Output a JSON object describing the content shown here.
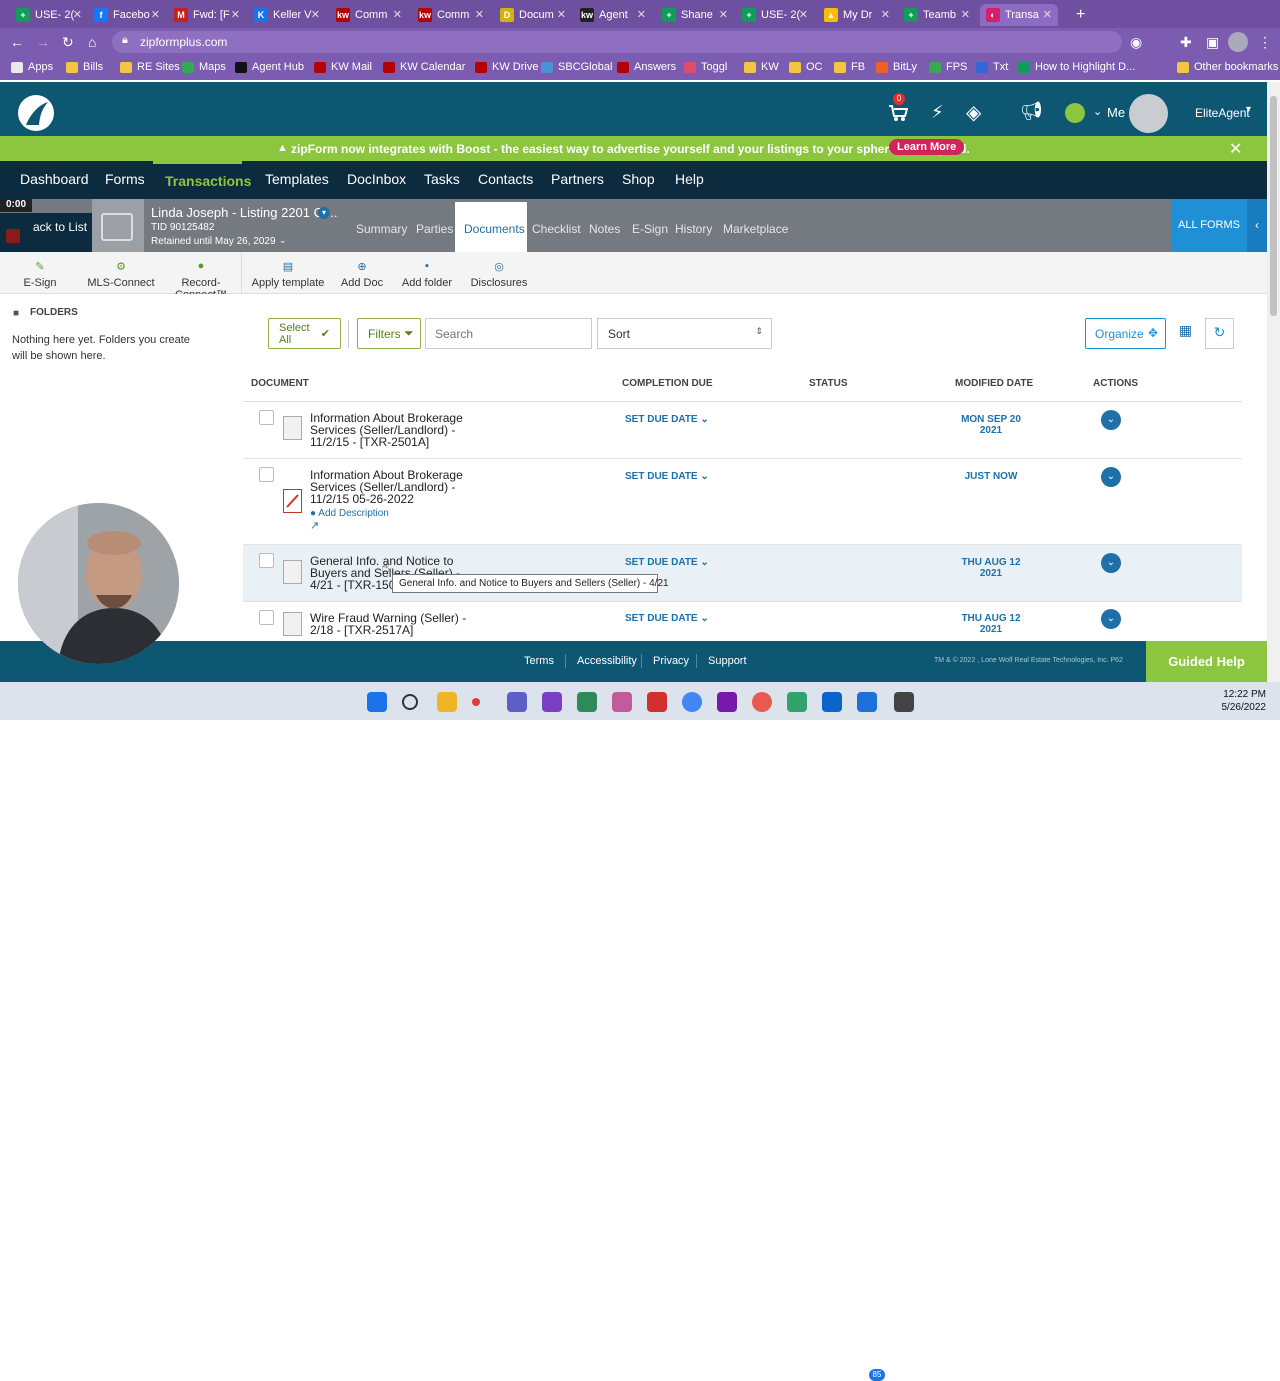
{
  "browser": {
    "tabs": [
      {
        "title": "USE- 2(",
        "color": "#0f9d58",
        "glyph": "+"
      },
      {
        "title": "Facebo",
        "color": "#1877f2",
        "glyph": "f"
      },
      {
        "title": "Fwd: [F",
        "color": "#c5221f",
        "glyph": "M"
      },
      {
        "title": "Keller V",
        "color": "#1a73e8",
        "glyph": "K"
      },
      {
        "title": "Comm",
        "color": "#b40101",
        "glyph": "kw"
      },
      {
        "title": "Comm",
        "color": "#b40101",
        "glyph": "kw"
      },
      {
        "title": "Docum",
        "color": "#d4b20a",
        "glyph": "D"
      },
      {
        "title": "Agent",
        "color": "#222222",
        "glyph": "kw"
      },
      {
        "title": "Shane",
        "color": "#0f9d58",
        "glyph": "+"
      },
      {
        "title": "USE- 2(",
        "color": "#0f9d58",
        "glyph": "+"
      },
      {
        "title": "My Dr",
        "color": "#fbbc04",
        "glyph": "▲"
      },
      {
        "title": "Teamb",
        "color": "#0f9d58",
        "glyph": "+"
      },
      {
        "title": "Transa",
        "color": "#d61f69",
        "glyph": "◐"
      }
    ],
    "new_tab": "+",
    "url": "zipformplus.com",
    "bookmarks": [
      {
        "label": "Apps",
        "color": "#e9e9e9"
      },
      {
        "label": "Bills",
        "color": "#f4c542"
      },
      {
        "label": "RE Sites",
        "color": "#f4c542"
      },
      {
        "label": "Maps",
        "color": "#34a853"
      },
      {
        "label": "Agent Hub",
        "color": "#111111"
      },
      {
        "label": "KW Mail",
        "color": "#b40101"
      },
      {
        "label": "KW Calendar",
        "color": "#b40101"
      },
      {
        "label": "KW Drive",
        "color": "#b40101"
      },
      {
        "label": "SBCGlobal",
        "color": "#4b8fd6"
      },
      {
        "label": "Answers",
        "color": "#b40101"
      },
      {
        "label": "Toggl",
        "color": "#e24c6b"
      },
      {
        "label": "KW",
        "color": "#f4c542"
      },
      {
        "label": "OC",
        "color": "#f4c542"
      },
      {
        "label": "FB",
        "color": "#f4c542"
      },
      {
        "label": "BitLy",
        "color": "#ee6123"
      },
      {
        "label": "FPS",
        "color": "#3aa757"
      },
      {
        "label": "Txt",
        "color": "#3367d6"
      },
      {
        "label": "How to Highlight D...",
        "color": "#0f9d58"
      },
      {
        "label": "Other bookmarks",
        "color": "#f4c542"
      }
    ]
  },
  "header": {
    "cart_count": "0",
    "me_label": "Me",
    "user_label": "EliteAgent"
  },
  "promo": {
    "text": "zipForm now integrates with Boost - the easiest way to advertise yourself and your listings to your sphere and beyond.",
    "button": "Learn More"
  },
  "nav": {
    "items": [
      "Dashboard",
      "Forms",
      "Transactions",
      "Templates",
      "DocInbox",
      "Tasks",
      "Contacts",
      "Partners",
      "Shop",
      "Help"
    ],
    "active": "Transactions"
  },
  "transaction": {
    "timer": "0:00",
    "back_label": "ack to List",
    "name": "Linda Joseph - Listing 2201 Cr...",
    "tid": "TID 90125482",
    "retained": "Retained until May 26, 2029",
    "tabs": [
      "Summary",
      "Parties",
      "Documents",
      "Checklist",
      "Notes",
      "E-Sign",
      "History",
      "Marketplace"
    ],
    "active_tab": "Documents",
    "all_forms": "ALL FORMS"
  },
  "toolbar": [
    "E-Sign",
    "MLS-Connect",
    "Record-Connect™",
    "Apply template",
    "Add Doc",
    "Add folder",
    "Disclosures"
  ],
  "sidebar": {
    "title": "FOLDERS",
    "empty_text": "Nothing here yet. Folders you create will be shown here."
  },
  "filters": {
    "select_all": "Select All",
    "filters": "Filters",
    "search_placeholder": "Search",
    "sort": "Sort",
    "organize": "Organize"
  },
  "columns": {
    "document": "DOCUMENT",
    "completion_due": "COMPLETION DUE",
    "status": "STATUS",
    "modified": "MODIFIED DATE",
    "actions": "ACTIONS"
  },
  "documents": [
    {
      "name": "Information About Brokerage Services (Seller/Landlord) - 11/2/15 - [TXR-2501A]",
      "due": "SET DUE DATE",
      "modified": "MON SEP 20 2021"
    },
    {
      "name": "Information About Brokerage Services (Seller/Landlord) - 11/2/15 05-26-2022",
      "due": "SET DUE DATE",
      "modified": "JUST NOW",
      "add_description": "Add Description"
    },
    {
      "name": "General Info. and Notice to Buyers and Sellers (Seller) - 4/21 - [TXR-1506A]",
      "due": "SET DUE DATE",
      "modified": "THU AUG 12 2021"
    },
    {
      "name": "Wire Fraud Warning (Seller) - 2/18 - [TXR-2517A]",
      "due": "SET DUE DATE",
      "modified": "THU AUG 12 2021"
    }
  ],
  "tooltip": "General Info. and Notice to Buyers and Sellers (Seller) - 4/21",
  "footer": {
    "links": [
      "Terms",
      "Accessibility",
      "Privacy",
      "Support"
    ],
    "copyright": "TM & © 2022 , Lone Wolf Real Estate Technologies, Inc. P62",
    "guided_help": "Guided Help"
  },
  "taskbar": {
    "time": "12:22 PM",
    "date": "5/26/2022",
    "badge": "85"
  }
}
